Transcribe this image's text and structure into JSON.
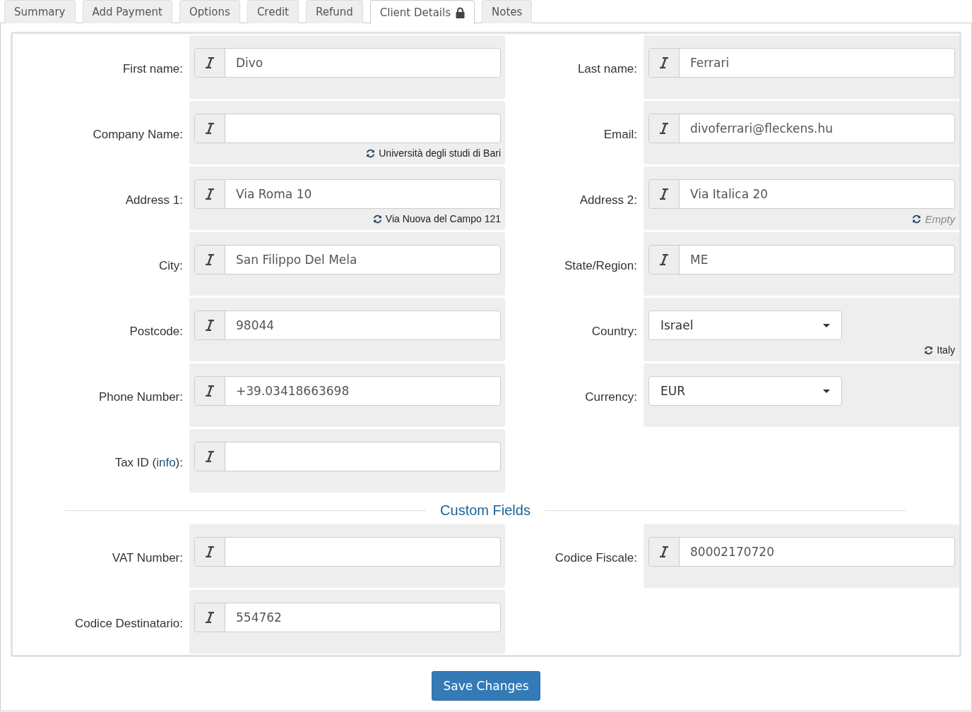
{
  "tabs": [
    {
      "label": "Summary",
      "selected": false,
      "locked": false
    },
    {
      "label": "Add Payment",
      "selected": false,
      "locked": false
    },
    {
      "label": "Options",
      "selected": false,
      "locked": false
    },
    {
      "label": "Credit",
      "selected": false,
      "locked": false
    },
    {
      "label": "Refund",
      "selected": false,
      "locked": false
    },
    {
      "label": "Client Details",
      "selected": true,
      "locked": true
    },
    {
      "label": "Notes",
      "selected": false,
      "locked": false
    }
  ],
  "rows": [
    {
      "left": {
        "label": "First name:",
        "kind": "text",
        "value": "Divo"
      },
      "right": {
        "label": "Last name:",
        "kind": "text",
        "value": "Ferrari"
      }
    },
    {
      "left": {
        "label": "Company Name:",
        "kind": "text",
        "hint": {
          "kind": "value",
          "text": "Università degli studi di Bari"
        }
      },
      "right": {
        "label": "Email:",
        "kind": "text",
        "value": "divoferrari@fleckens.hu"
      }
    },
    {
      "left": {
        "label": "Address 1:",
        "kind": "text",
        "value": "Via Roma 10",
        "hint": {
          "kind": "value",
          "text": "Via Nuova del Campo 121"
        }
      },
      "right": {
        "label": "Address 2:",
        "kind": "text",
        "value": "Via Italica 20",
        "hint": {
          "kind": "empty",
          "text": "Empty"
        }
      }
    },
    {
      "left": {
        "label": "City:",
        "kind": "text",
        "value": "San Filippo Del Mela"
      },
      "right": {
        "label": "State/Region:",
        "kind": "text",
        "value": "ME"
      }
    },
    {
      "left": {
        "label": "Postcode:",
        "kind": "text",
        "value": "98044"
      },
      "right": {
        "label": "Country:",
        "kind": "select",
        "value": "Israel",
        "hint": {
          "kind": "value",
          "text": "Italy"
        }
      }
    },
    {
      "left": {
        "label": "Phone Number:",
        "kind": "text",
        "value": "+39.03418663698"
      },
      "right": {
        "label": "Currency:",
        "kind": "select",
        "value": "EUR"
      }
    },
    {
      "left": {
        "label": "Tax ID (",
        "link": "info",
        "label_end": "):",
        "kind": "text"
      }
    }
  ],
  "custom_fields_title": "Custom Fields",
  "custom_rows": [
    {
      "left": {
        "label": "VAT Number:",
        "kind": "text"
      },
      "right": {
        "label": "Codice Fiscale:",
        "kind": "text",
        "value": "80002170720"
      }
    },
    {
      "left": {
        "label": "Codice Destinatario:",
        "kind": "text",
        "value": "554762"
      }
    }
  ],
  "save_button": "Save Changes"
}
